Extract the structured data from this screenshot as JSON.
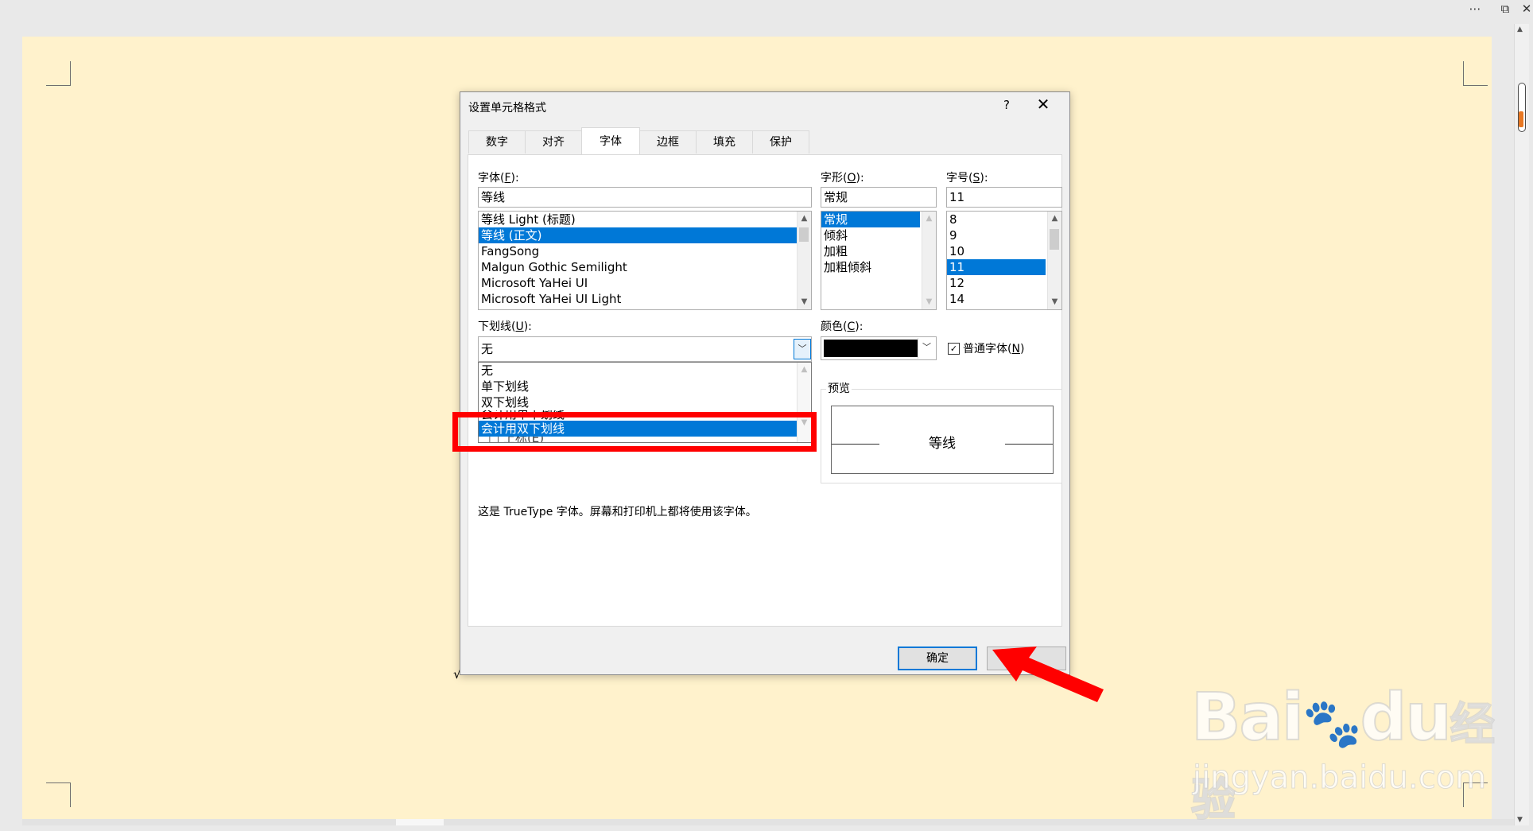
{
  "window": {
    "more_icon": "more-icon",
    "restore_icon": "restore-icon",
    "close_icon": "close-icon"
  },
  "dialog": {
    "title": "设置单元格格式",
    "help_label": "?",
    "close_label": "✕",
    "tabs": [
      {
        "label": "数字",
        "active": false
      },
      {
        "label": "对齐",
        "active": false
      },
      {
        "label": "字体",
        "active": true
      },
      {
        "label": "边框",
        "active": false
      },
      {
        "label": "填充",
        "active": false
      },
      {
        "label": "保护",
        "active": false
      }
    ],
    "font": {
      "label": "字体(F):",
      "label_main": "字体(",
      "label_key": "F",
      "label_end": "):",
      "value": "等线",
      "items": [
        "等线 Light (标题)",
        "等线 (正文)",
        "FangSong",
        "Malgun Gothic Semilight",
        "Microsoft YaHei UI",
        "Microsoft YaHei UI Light"
      ],
      "selected_index": 1
    },
    "style": {
      "label_main": "字形(",
      "label_key": "O",
      "label_end": "):",
      "value": "常规",
      "items": [
        "常规",
        "倾斜",
        "加粗",
        "加粗倾斜"
      ],
      "selected_index": 0
    },
    "size": {
      "label_main": "字号(",
      "label_key": "S",
      "label_end": "):",
      "value": "11",
      "items": [
        "8",
        "9",
        "10",
        "11",
        "12",
        "14"
      ],
      "selected_index": 3
    },
    "underline": {
      "label_main": "下划线(",
      "label_key": "U",
      "label_end": "):",
      "value": "无",
      "options": [
        "无",
        "单下划线",
        "双下划线",
        "会计用单下划线",
        "会计用双下划线"
      ],
      "selected_index": 4,
      "partial_text": "□ 上标(E)"
    },
    "color": {
      "label_main": "颜色(",
      "label_key": "C",
      "label_end": "):",
      "value_hex": "#000000"
    },
    "normal_font": {
      "label_main": "普通字体(",
      "label_key": "N",
      "label_end": ")",
      "checked": true
    },
    "preview": {
      "label": "预览",
      "sample": "等线"
    },
    "info_text": "这是 TrueType 字体。屏幕和打印机上都将使用该字体。",
    "ok_label": "确定",
    "cancel_label": ""
  },
  "stray_mark": "√",
  "watermark": {
    "brand": "Bai",
    "brand_tail": "du",
    "brand_cn": "经验",
    "url": "jingyan.baidu.com"
  },
  "colors": {
    "page_bg": "#fff2cc",
    "selection": "#0078d7",
    "highlight": "#ff0000"
  }
}
